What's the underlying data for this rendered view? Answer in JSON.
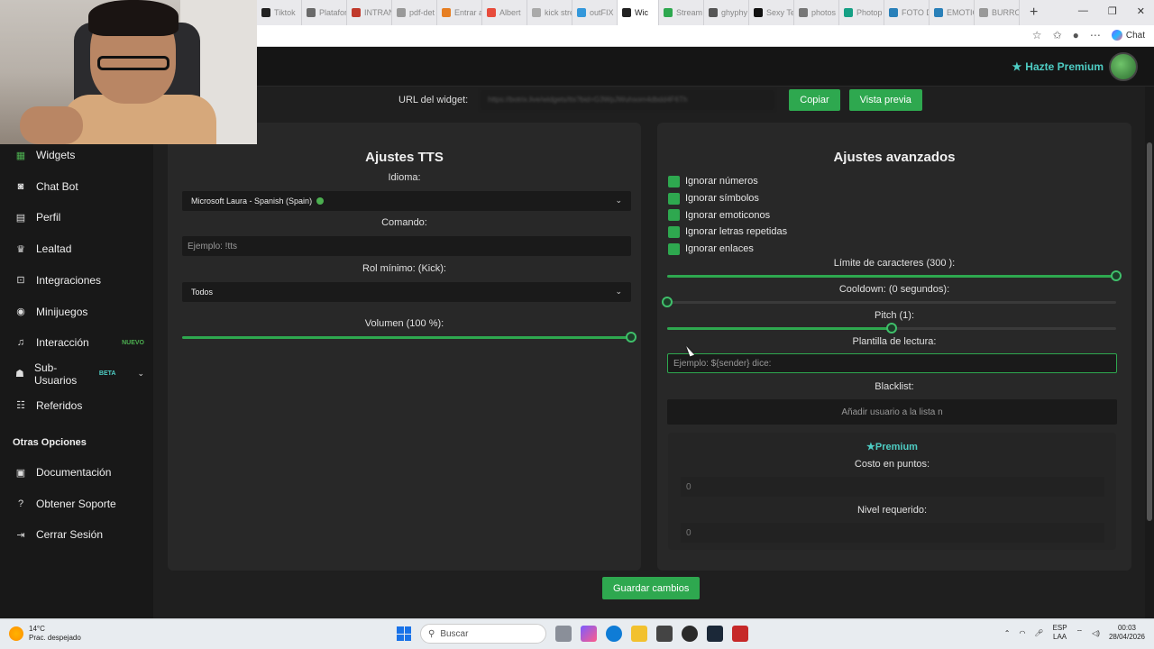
{
  "browser": {
    "tabs": [
      {
        "label": "Tiktok",
        "color": "#222222"
      },
      {
        "label": "Plataformas",
        "color": "#6a6a6a"
      },
      {
        "label": "INTRANET",
        "color": "#c0392b"
      },
      {
        "label": "pdf-det",
        "color": "#999999"
      },
      {
        "label": "Entrar a",
        "color": "#e67e22"
      },
      {
        "label": "Albert",
        "color": "#e74c3c"
      },
      {
        "label": "kick strea",
        "color": "#aaaaaa"
      },
      {
        "label": "outFIX",
        "color": "#3498db"
      },
      {
        "label": "Wic",
        "color": "#222222",
        "active": true
      },
      {
        "label": "Stream",
        "color": "#2ea84f"
      },
      {
        "label": "ghyphy",
        "color": "#555555"
      },
      {
        "label": "Sexy Te",
        "color": "#111111"
      },
      {
        "label": "photos",
        "color": "#777777"
      },
      {
        "label": "Photop",
        "color": "#16a085"
      },
      {
        "label": "FOTO D",
        "color": "#2980b9"
      },
      {
        "label": "EMOTIC",
        "color": "#2980b9"
      },
      {
        "label": "BURRO",
        "color": "#999999"
      }
    ],
    "chat_label": "Chat"
  },
  "header": {
    "premium_label": "Hazte Premium"
  },
  "sidebar": {
    "items": [
      {
        "label": "Widgets",
        "icon": "grid-icon",
        "active": true
      },
      {
        "label": "Chat Bot",
        "icon": "robot-icon"
      },
      {
        "label": "Perfil",
        "icon": "id-card-icon"
      },
      {
        "label": "Lealtad",
        "icon": "trophy-icon"
      },
      {
        "label": "Integraciones",
        "icon": "plug-icon"
      },
      {
        "label": "Minijuegos",
        "icon": "gamepad-icon"
      },
      {
        "label": "Interacción",
        "icon": "music-icon",
        "badge": "NUEVO"
      },
      {
        "label": "Sub-Usuarios",
        "icon": "users-icon",
        "badge": "BETA"
      },
      {
        "label": "Referidos",
        "icon": "people-icon"
      }
    ],
    "section_title": "Otras Opciones",
    "other_items": [
      {
        "label": "Documentación",
        "icon": "book-icon"
      },
      {
        "label": "Obtener Soporte",
        "icon": "help-icon"
      },
      {
        "label": "Cerrar Sesión",
        "icon": "logout-icon"
      }
    ]
  },
  "widget_url": {
    "label": "URL del widget:",
    "value": "https://botrix.live/widgets/tts?bid=G3WpJWuhsom4dbdd4F6Th",
    "copy_label": "Copiar",
    "preview_label": "Vista previa"
  },
  "tts": {
    "title": "Ajustes TTS",
    "language_label": "Idioma:",
    "language_value": "Microsoft Laura - Spanish (Spain)",
    "command_label": "Comando:",
    "command_placeholder": "Ejemplo: !tts",
    "role_label": "Rol mínimo: (Kick):",
    "role_value": "Todos",
    "volume_label": "Volumen (100 %):",
    "volume_fraction": 1.0
  },
  "advanced": {
    "title": "Ajustes avanzados",
    "checkboxes": [
      {
        "label": "Ignorar números",
        "checked": true
      },
      {
        "label": "Ignorar símbolos",
        "checked": true
      },
      {
        "label": "Ignorar emoticonos",
        "checked": true
      },
      {
        "label": "Ignorar letras repetidas",
        "checked": true
      },
      {
        "label": "Ignorar enlaces",
        "checked": true
      }
    ],
    "char_limit_label": "Límite de caracteres (300 ):",
    "char_limit_fraction": 1.0,
    "cooldown_label": "Cooldown: (0 segundos):",
    "cooldown_fraction": 0.0,
    "pitch_label": "Pitch (1):",
    "pitch_fraction": 0.5,
    "template_label": "Plantilla de lectura:",
    "template_placeholder": "Ejemplo: ${sender} dice:",
    "blacklist_label": "Blacklist:",
    "blacklist_placeholder": "Añadir usuario a la lista n",
    "premium": {
      "title": "Premium",
      "cost_label": "Costo en puntos:",
      "cost_value": "0",
      "level_label": "Nivel requerido:",
      "level_value": "0"
    }
  },
  "save_label": "Guardar cambios",
  "taskbar": {
    "temperature": "14°C",
    "weather": "Prac. despejado",
    "search_placeholder": "Buscar",
    "lang_line1": "ESP",
    "lang_line2": "LAA",
    "time": "00:03",
    "date": "28/04/2026"
  },
  "colors": {
    "accent": "#2ea84f",
    "premium": "#4ecdc4",
    "panel": "#282828",
    "background": "#1f1f1f"
  }
}
